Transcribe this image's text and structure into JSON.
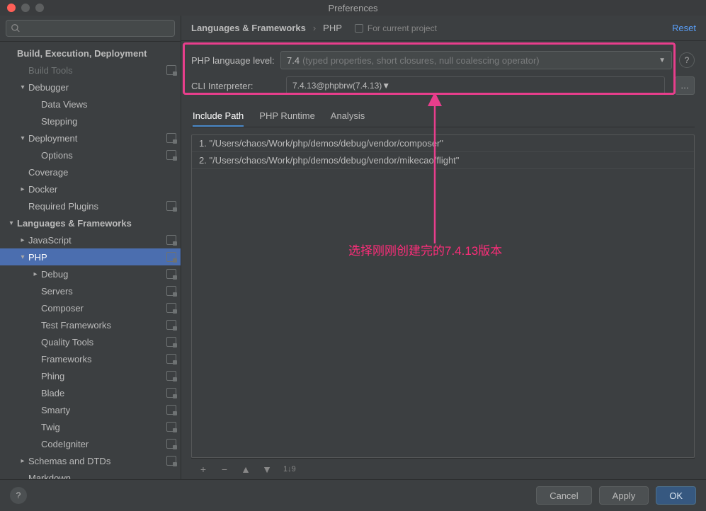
{
  "window": {
    "title": "Preferences"
  },
  "sidebar": {
    "search_placeholder": "",
    "items": [
      {
        "label": "Build, Execution, Deployment",
        "bold": true,
        "arrow": "",
        "indent": 0
      },
      {
        "label": "Build Tools",
        "arrow": "",
        "indent": 1,
        "badge": true,
        "dim": true
      },
      {
        "label": "Debugger",
        "arrow": "v",
        "indent": 1
      },
      {
        "label": "Data Views",
        "arrow": "",
        "indent": 2
      },
      {
        "label": "Stepping",
        "arrow": "",
        "indent": 2
      },
      {
        "label": "Deployment",
        "arrow": "v",
        "indent": 1,
        "badge": true
      },
      {
        "label": "Options",
        "arrow": "",
        "indent": 2,
        "badge": true
      },
      {
        "label": "Coverage",
        "arrow": "",
        "indent": 1
      },
      {
        "label": "Docker",
        "arrow": ">",
        "indent": 1
      },
      {
        "label": "Required Plugins",
        "arrow": "",
        "indent": 1,
        "badge": true
      },
      {
        "label": "Languages & Frameworks",
        "bold": true,
        "arrow": "v",
        "indent": 0
      },
      {
        "label": "JavaScript",
        "arrow": ">",
        "indent": 1,
        "badge": true
      },
      {
        "label": "PHP",
        "arrow": "v",
        "indent": 1,
        "badge": true,
        "selected": true
      },
      {
        "label": "Debug",
        "arrow": ">",
        "indent": 2,
        "badge": true
      },
      {
        "label": "Servers",
        "arrow": "",
        "indent": 2,
        "badge": true
      },
      {
        "label": "Composer",
        "arrow": "",
        "indent": 2,
        "badge": true
      },
      {
        "label": "Test Frameworks",
        "arrow": "",
        "indent": 2,
        "badge": true
      },
      {
        "label": "Quality Tools",
        "arrow": "",
        "indent": 2,
        "badge": true
      },
      {
        "label": "Frameworks",
        "arrow": "",
        "indent": 2,
        "badge": true
      },
      {
        "label": "Phing",
        "arrow": "",
        "indent": 2,
        "badge": true
      },
      {
        "label": "Blade",
        "arrow": "",
        "indent": 2,
        "badge": true
      },
      {
        "label": "Smarty",
        "arrow": "",
        "indent": 2,
        "badge": true
      },
      {
        "label": "Twig",
        "arrow": "",
        "indent": 2,
        "badge": true
      },
      {
        "label": "CodeIgniter",
        "arrow": "",
        "indent": 2,
        "badge": true
      },
      {
        "label": "Schemas and DTDs",
        "arrow": ">",
        "indent": 1,
        "badge": true
      },
      {
        "label": "Markdown",
        "arrow": "",
        "indent": 1
      }
    ]
  },
  "header": {
    "breadcrumb": [
      "Languages & Frameworks",
      "PHP"
    ],
    "for_project": "For current project",
    "reset": "Reset"
  },
  "form": {
    "lang_level_label": "PHP language level:",
    "lang_level_value": "7.4",
    "lang_level_hint": "(typed properties, short closures, null coalescing operator)",
    "cli_label": "CLI Interpreter:",
    "cli_value": "7.4.13@phpbrw",
    "cli_hint": "(7.4.13)"
  },
  "tabs": {
    "items": [
      "Include Path",
      "PHP Runtime",
      "Analysis"
    ],
    "active": 0
  },
  "list": [
    "1.  \"/Users/chaos/Work/php/demos/debug/vendor/composer\"",
    "2.  \"/Users/chaos/Work/php/demos/debug/vendor/mikecao/flight\""
  ],
  "list_toolbar": {
    "sort_label": "1↓9"
  },
  "annotation": {
    "text": "选择刚刚创建完的7.4.13版本"
  },
  "footer": {
    "cancel": "Cancel",
    "apply": "Apply",
    "ok": "OK"
  }
}
